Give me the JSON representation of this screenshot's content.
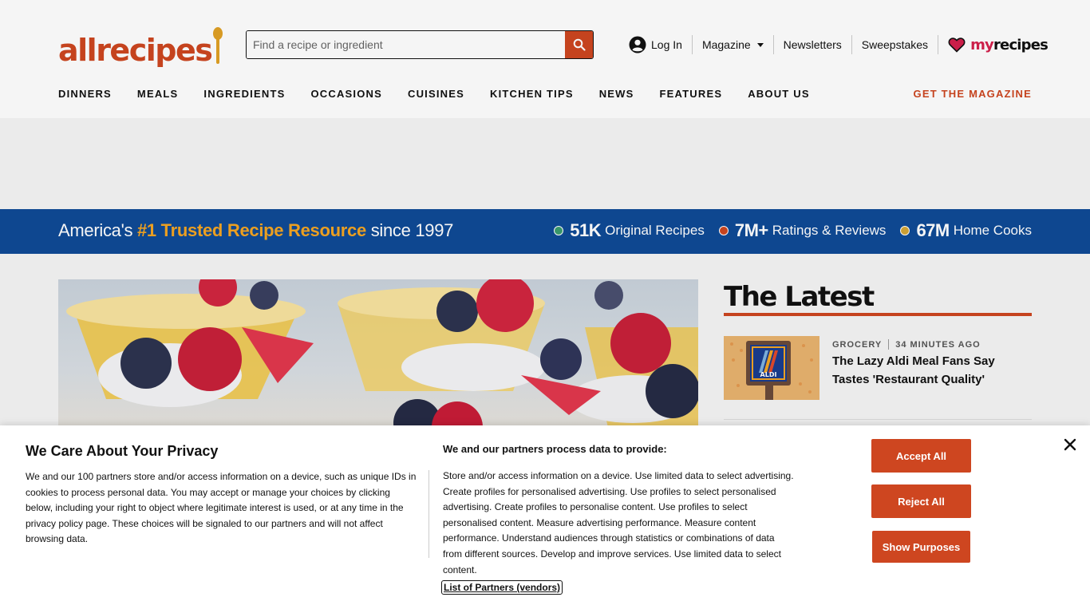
{
  "header": {
    "logo_text": "allrecipes",
    "search_placeholder": "Find a recipe or ingredient",
    "links": {
      "login": "Log In",
      "magazine": "Magazine",
      "newsletters": "Newsletters",
      "sweepstakes": "Sweepstakes"
    },
    "myrecipes": {
      "my": "my",
      "recipes": "recipes"
    }
  },
  "nav": {
    "items": [
      "DINNERS",
      "MEALS",
      "INGREDIENTS",
      "OCCASIONS",
      "CUISINES",
      "KITCHEN TIPS",
      "NEWS",
      "FEATURES",
      "ABOUT US"
    ],
    "cta": "GET THE MAGAZINE"
  },
  "banner": {
    "prefix": "America's ",
    "highlight": "#1 Trusted Recipe Resource",
    "suffix": " since 1997",
    "stats": [
      {
        "num": "51K",
        "label": "Original Recipes",
        "color": "#3a9d6f"
      },
      {
        "num": "7M+",
        "label": "Ratings & Reviews",
        "color": "#ce4620"
      },
      {
        "num": "67M",
        "label": "Home Cooks",
        "color": "#d4a637"
      }
    ]
  },
  "latest": {
    "title": "The Latest",
    "item": {
      "category": "GROCERY",
      "time": "34 MINUTES AGO",
      "headline": "The Lazy Aldi Meal Fans Say Tastes 'Restaurant Quality'",
      "thumb_label": "ALDI"
    }
  },
  "consent": {
    "title": "We Care About Your Privacy",
    "text": "We and our 100 partners store and/or access information on a device, such as unique IDs in cookies to process personal data. You may accept or manage your choices by clicking below, including your right to object where legitimate interest is used, or at any time in the privacy policy page. These choices will be signaled to our partners and will not affect browsing data.",
    "subtitle": "We and our partners process data to provide:",
    "purposes": "Store and/or access information on a device. Use limited data to select advertising. Create profiles for personalised advertising. Use profiles to select personalised advertising. Create profiles to personalise content. Use profiles to select personalised content. Measure advertising performance. Measure content performance. Understand audiences through statistics or combinations of data from different sources. Develop and improve services. Use limited data to select content.",
    "partners_link": "List of Partners (vendors)",
    "buttons": {
      "accept": "Accept All",
      "reject": "Reject All",
      "purposes": "Show Purposes"
    }
  },
  "colors": {
    "brand": "#ce4620",
    "banner_bg": "#0f4a96",
    "highlight": "#f5a623"
  }
}
